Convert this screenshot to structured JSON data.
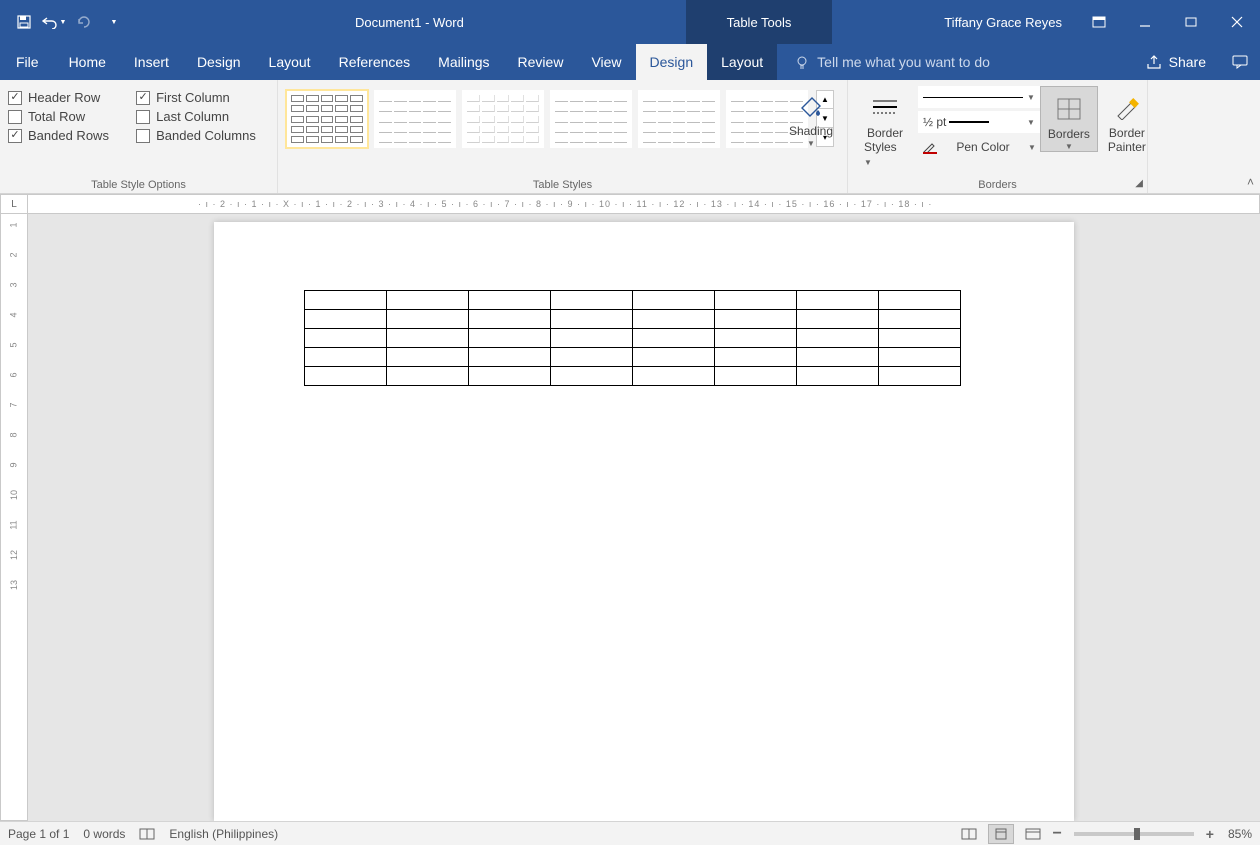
{
  "title": {
    "document": "Document1",
    "app": "Word",
    "separator": "  -  ",
    "context_tab": "Table Tools"
  },
  "user": {
    "name": "Tiffany Grace Reyes"
  },
  "tabs": {
    "file": "File",
    "home": "Home",
    "insert": "Insert",
    "design_main": "Design",
    "layout_main": "Layout",
    "references": "References",
    "mailings": "Mailings",
    "review": "Review",
    "view": "View",
    "design_ctx": "Design",
    "layout_ctx": "Layout",
    "tellme_placeholder": "Tell me what you want to do",
    "share": "Share"
  },
  "ribbon": {
    "style_options": {
      "group_label": "Table Style Options",
      "header_row": {
        "label": "Header Row",
        "checked": true
      },
      "total_row": {
        "label": "Total Row",
        "checked": false
      },
      "banded_rows": {
        "label": "Banded Rows",
        "checked": true
      },
      "first_column": {
        "label": "First Column",
        "checked": true
      },
      "last_column": {
        "label": "Last Column",
        "checked": false
      },
      "banded_columns": {
        "label": "Banded Columns",
        "checked": false
      }
    },
    "table_styles_label": "Table Styles",
    "shading": "Shading",
    "border_styles": {
      "line1": "Border",
      "line2": "Styles"
    },
    "pen_weight": "½ pt",
    "pen_color": "Pen Color",
    "borders": "Borders",
    "border_painter": {
      "line1": "Border",
      "line2": "Painter"
    },
    "borders_group_label": "Borders"
  },
  "document": {
    "table": {
      "rows": 5,
      "cols": 8
    }
  },
  "ruler_h": "· ı · 2 · ı · 1 · ı · X · ı · 1 · ı · 2 · ı · 3 · ı · 4 · ı · 5 · ı · 6 · ı · 7 · ı · 8 · ı · 9 · ı · 10 · ı · 11 · ı · 12 · ı · 13 · ı · 14 · ı · 15 · ı · 16 · ı · 17 · ı · 18 · ı ·",
  "ruler_v": [
    "1",
    "2",
    "3",
    "4",
    "5",
    "6",
    "7",
    "8",
    "9",
    "10",
    "11",
    "12",
    "13"
  ],
  "statusbar": {
    "page": "Page 1 of 1",
    "words": "0 words",
    "language": "English (Philippines)",
    "zoom": "85%"
  }
}
